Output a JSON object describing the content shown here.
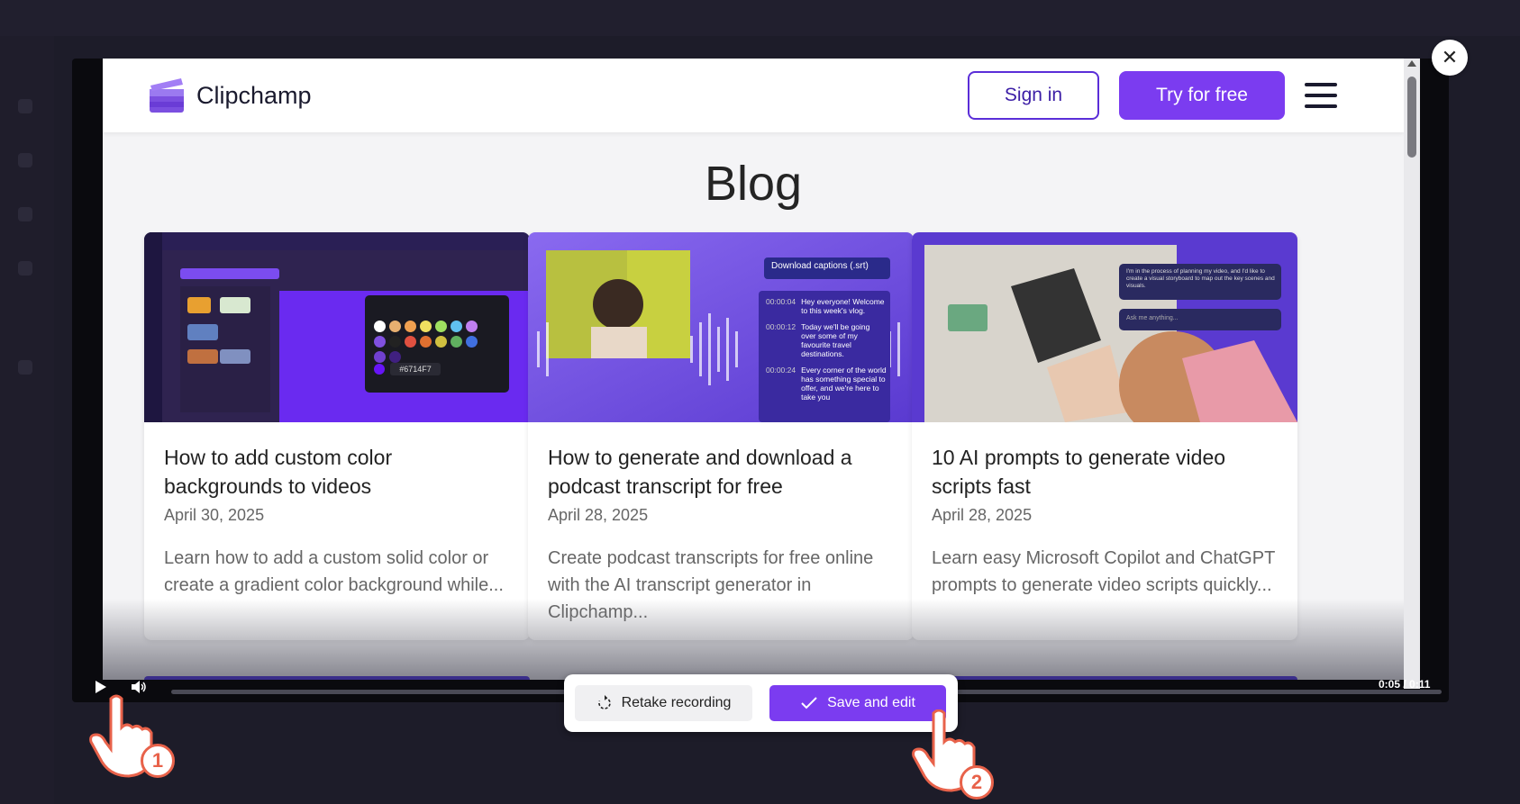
{
  "site": {
    "brand": "Clipchamp",
    "sign_in": "Sign in",
    "try_free": "Try for free",
    "page_title": "Blog"
  },
  "cards": [
    {
      "title": "How to add custom color backgrounds to videos",
      "date": "April 30, 2025",
      "desc": "Learn how to add a custom solid color or create a gradient color background while...",
      "thumb": {
        "hex_label": "#6714F7"
      }
    },
    {
      "title": "How to generate and download a podcast transcript for free",
      "date": "April 28, 2025",
      "desc": "Create podcast transcripts for free online with the AI transcript generator in Clipchamp...",
      "thumb": {
        "download_label": "Download captions (.srt)",
        "captions": [
          {
            "time": "00:00:04",
            "text": "Hey everyone! Welcome to this week's vlog."
          },
          {
            "time": "00:00:12",
            "text": "Today we'll be going over some of my favourite travel destinations."
          },
          {
            "time": "00:00:24",
            "text": "Every corner of the world has something special to offer, and we're here to take you"
          }
        ]
      }
    },
    {
      "title": "10 AI prompts to generate video scripts fast",
      "date": "April 28, 2025",
      "desc": "Learn easy Microsoft Copilot and ChatGPT prompts to generate video scripts quickly...",
      "thumb": {
        "chat_message": "I'm in the process of planning my video, and I'd like to create a visual storyboard to map out the key scenes and visuals.",
        "ask_placeholder": "Ask me anything..."
      }
    }
  ],
  "player": {
    "time": "0:05 / 0:11"
  },
  "actions": {
    "retake": "Retake recording",
    "save": "Save and edit"
  },
  "steps": {
    "step1": "1",
    "step2": "2"
  },
  "colors": {
    "accent": "#7b3cf0",
    "badge": "#e8624a"
  }
}
